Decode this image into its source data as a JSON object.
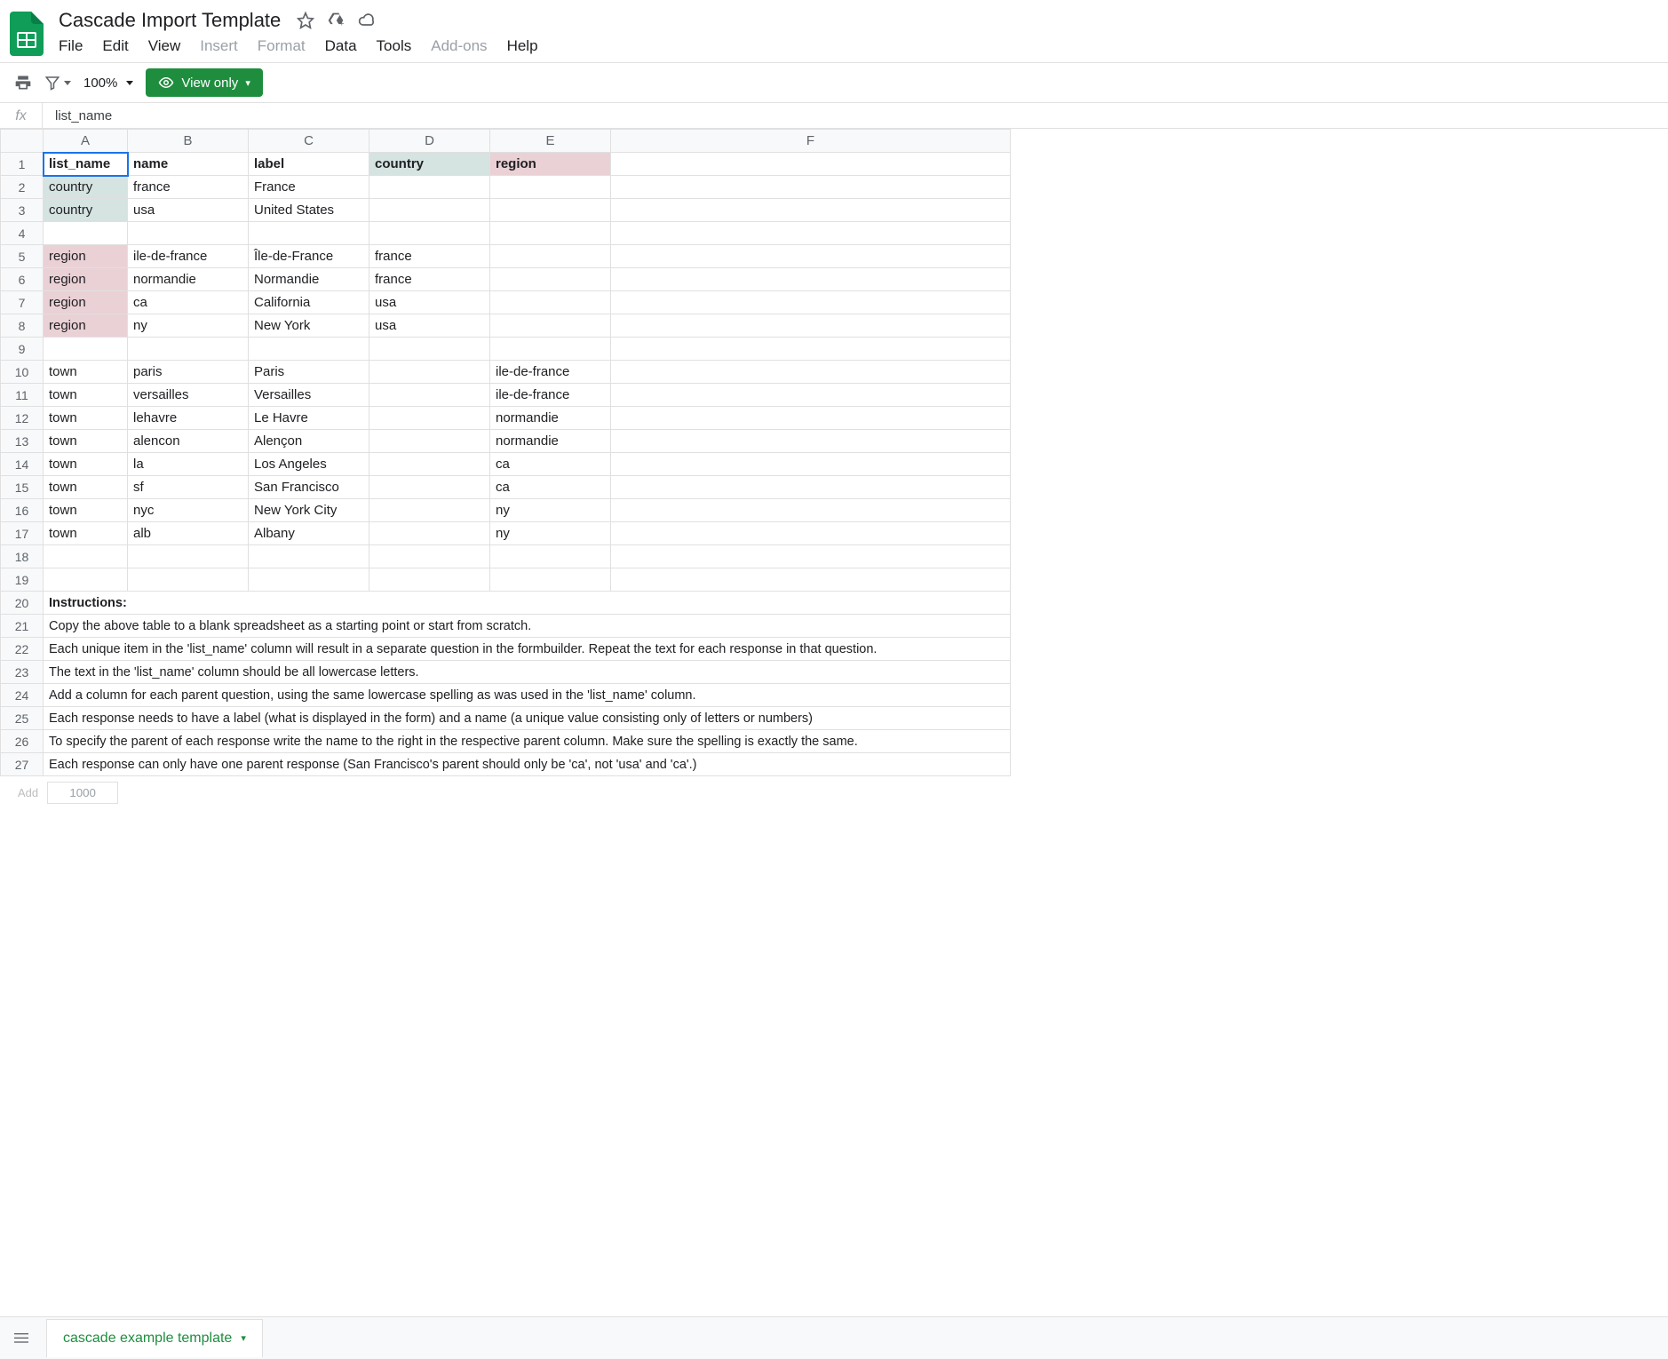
{
  "doc_title": "Cascade Import Template",
  "menu": {
    "file": "File",
    "edit": "Edit",
    "view": "View",
    "insert": "Insert",
    "format": "Format",
    "data": "Data",
    "tools": "Tools",
    "addons": "Add-ons",
    "help": "Help"
  },
  "toolbar": {
    "zoom": "100%",
    "view_only": "View only"
  },
  "formula": {
    "fx": "fx",
    "value": "list_name"
  },
  "cols": [
    "A",
    "B",
    "C",
    "D",
    "E",
    "F"
  ],
  "headers": {
    "A": "list_name",
    "B": "name",
    "C": "label",
    "D": "country",
    "E": "region"
  },
  "rows": [
    {
      "n": 2,
      "A": "country",
      "B": "france",
      "C": "France",
      "highlightA": "country"
    },
    {
      "n": 3,
      "A": "country",
      "B": "usa",
      "C": "United States",
      "highlightA": "country"
    },
    {
      "n": 4
    },
    {
      "n": 5,
      "A": "region",
      "B": "ile-de-france",
      "C": "Île-de-France",
      "D": "france",
      "highlightA": "region"
    },
    {
      "n": 6,
      "A": "region",
      "B": "normandie",
      "C": "Normandie",
      "D": "france",
      "highlightA": "region"
    },
    {
      "n": 7,
      "A": "region",
      "B": "ca",
      "C": "California",
      "D": "usa",
      "highlightA": "region"
    },
    {
      "n": 8,
      "A": "region",
      "B": "ny",
      "C": "New York",
      "D": "usa",
      "highlightA": "region"
    },
    {
      "n": 9
    },
    {
      "n": 10,
      "A": "town",
      "B": "paris",
      "C": "Paris",
      "E": "ile-de-france"
    },
    {
      "n": 11,
      "A": "town",
      "B": "versailles",
      "C": "Versailles",
      "E": "ile-de-france"
    },
    {
      "n": 12,
      "A": "town",
      "B": "lehavre",
      "C": "Le Havre",
      "E": "normandie"
    },
    {
      "n": 13,
      "A": "town",
      "B": "alencon",
      "C": "Alençon",
      "E": "normandie"
    },
    {
      "n": 14,
      "A": "town",
      "B": "la",
      "C": "Los Angeles",
      "E": "ca"
    },
    {
      "n": 15,
      "A": "town",
      "B": "sf",
      "C": "San Francisco",
      "E": "ca"
    },
    {
      "n": 16,
      "A": "town",
      "B": "nyc",
      "C": "New York City",
      "E": "ny"
    },
    {
      "n": 17,
      "A": "town",
      "B": "alb",
      "C": "Albany",
      "E": "ny"
    },
    {
      "n": 18
    },
    {
      "n": 19
    }
  ],
  "instructions_header": {
    "n": 20,
    "text": "Instructions:"
  },
  "instructions": [
    {
      "n": 21,
      "text": "Copy the above table to a blank spreadsheet as a starting point or start from scratch."
    },
    {
      "n": 22,
      "text": "Each unique item in the 'list_name' column will result in a separate question in the formbuilder. Repeat the text for each response in that question."
    },
    {
      "n": 23,
      "text": "The text in the 'list_name' column should be all lowercase letters."
    },
    {
      "n": 24,
      "text": "Add a column for each parent question, using the same lowercase spelling as was used in the 'list_name' column."
    },
    {
      "n": 25,
      "text": "Each response needs to have a label (what is displayed in the form) and a name (a unique value consisting only of letters or numbers)"
    },
    {
      "n": 26,
      "text": "To specify the parent of each response write the name to the right in the respective parent column. Make sure the spelling is exactly the same."
    },
    {
      "n": 27,
      "text": "Each response can only have one parent response (San Francisco's parent should only be 'ca', not 'usa' and 'ca'.)"
    }
  ],
  "footer": {
    "add": "Add",
    "more_rows": "1000",
    "sheet_tab": "cascade example template"
  }
}
